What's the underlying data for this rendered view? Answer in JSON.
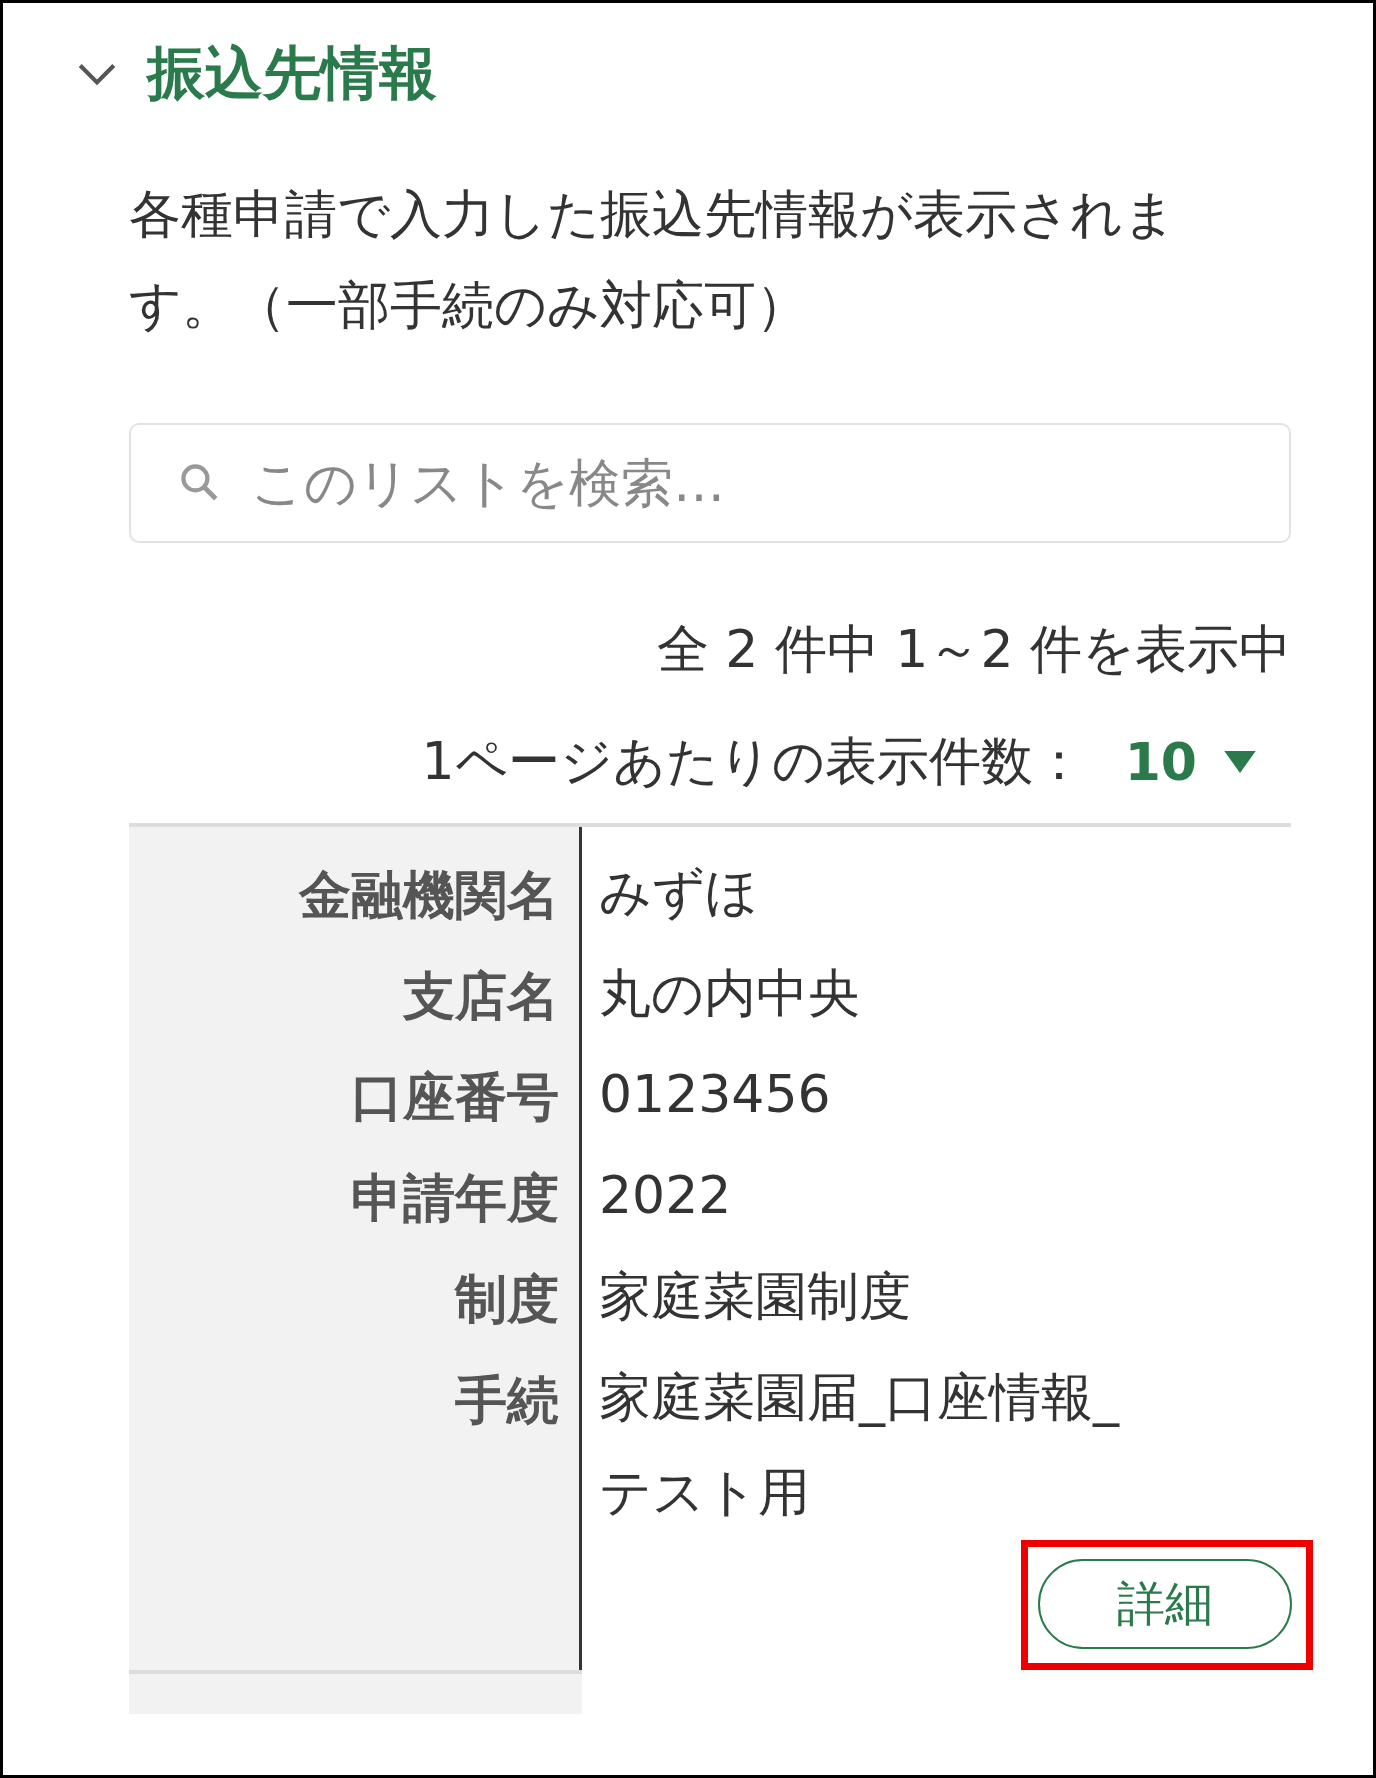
{
  "section": {
    "title": "振込先情報",
    "expanded": true
  },
  "description": "各種申請で入力した振込先情報が表示されます。（一部手続のみ対応可）",
  "search": {
    "placeholder": "このリストを検索…"
  },
  "count_text": "全 2 件中 1～2 件を表示中",
  "page_size": {
    "label": "1ページあたりの表示件数：",
    "value": "10"
  },
  "records": [
    {
      "fields": [
        {
          "label": "金融機関名",
          "value": "みずほ"
        },
        {
          "label": "支店名",
          "value": "丸の内中央"
        },
        {
          "label": "口座番号",
          "value": "0123456"
        },
        {
          "label": "申請年度",
          "value": "2022"
        },
        {
          "label": "制度",
          "value": "家庭菜園制度"
        },
        {
          "label": "手続",
          "value": "家庭菜園届_口座情報_テスト用"
        }
      ],
      "button": "詳細"
    }
  ]
}
